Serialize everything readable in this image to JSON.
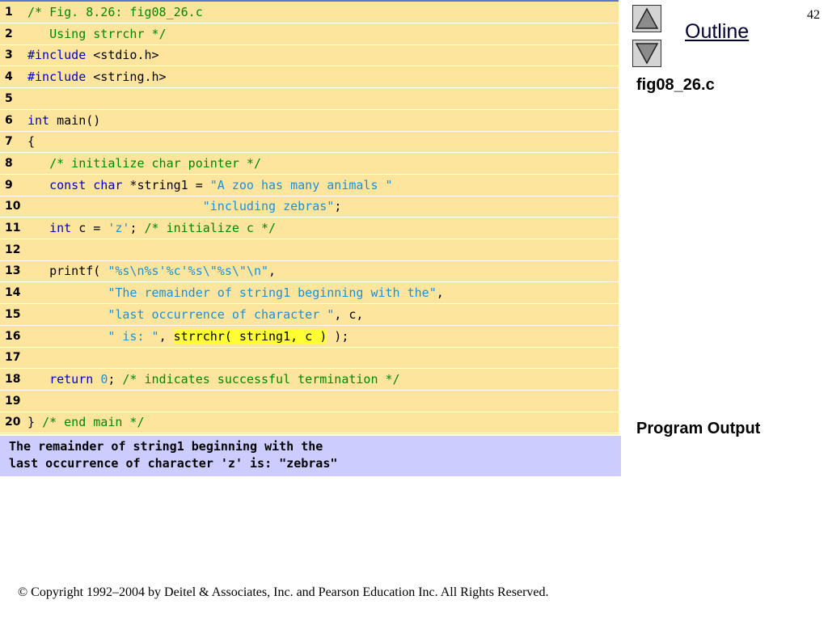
{
  "slide_number": "42",
  "nav": {
    "outline_label": "Outline",
    "up_icon": "triangle-up-icon",
    "down_icon": "triangle-down-icon"
  },
  "file_label": "fig08_26.c",
  "program_output_label": "Program Output",
  "code": [
    {
      "n": "1",
      "parts": [
        [
          "cm",
          "/* Fig. 8.26: fig08_26.c"
        ]
      ]
    },
    {
      "n": "2",
      "parts": [
        [
          "cm",
          "   Using strrchr */"
        ]
      ]
    },
    {
      "n": "3",
      "parts": [
        [
          "kw",
          "#include"
        ],
        [
          "",
          " <stdio.h>"
        ]
      ]
    },
    {
      "n": "4",
      "parts": [
        [
          "kw",
          "#include"
        ],
        [
          "",
          " <string.h>"
        ]
      ]
    },
    {
      "n": "5",
      "parts": []
    },
    {
      "n": "6",
      "parts": [
        [
          "kw",
          "int"
        ],
        [
          "",
          " main()"
        ]
      ]
    },
    {
      "n": "7",
      "parts": [
        [
          "",
          "{"
        ]
      ]
    },
    {
      "n": "8",
      "parts": [
        [
          "",
          "   "
        ],
        [
          "cm",
          "/* initialize char pointer */"
        ]
      ]
    },
    {
      "n": "9",
      "parts": [
        [
          "",
          "   "
        ],
        [
          "kw",
          "const"
        ],
        [
          "",
          " "
        ],
        [
          "kw",
          "char"
        ],
        [
          "",
          " *string1 = "
        ],
        [
          "st",
          "\"A zoo has many animals \""
        ]
      ]
    },
    {
      "n": "10",
      "parts": [
        [
          "",
          "                        "
        ],
        [
          "st",
          "\"including zebras\""
        ],
        [
          "",
          ";"
        ]
      ]
    },
    {
      "n": "11",
      "parts": [
        [
          "",
          "   "
        ],
        [
          "kw",
          "int"
        ],
        [
          "",
          " c = "
        ],
        [
          "st",
          "'z'"
        ],
        [
          "",
          "; "
        ],
        [
          "cm",
          "/* initialize c */"
        ]
      ]
    },
    {
      "n": "12",
      "parts": []
    },
    {
      "n": "13",
      "parts": [
        [
          "",
          "   printf( "
        ],
        [
          "st",
          "\"%s\\n%s'%c'%s\\\"%s\\\"\\n\""
        ],
        [
          "",
          ","
        ]
      ]
    },
    {
      "n": "14",
      "parts": [
        [
          "",
          "           "
        ],
        [
          "st",
          "\"The remainder of string1 beginning with the\""
        ],
        [
          "",
          ","
        ]
      ]
    },
    {
      "n": "15",
      "parts": [
        [
          "",
          "           "
        ],
        [
          "st",
          "\"last occurrence of character \""
        ],
        [
          "",
          ", c,"
        ]
      ]
    },
    {
      "n": "16",
      "parts": [
        [
          "",
          "           "
        ],
        [
          "st",
          "\" is: \""
        ],
        [
          "",
          ", "
        ],
        [
          "hl",
          "strrchr( string1, c )"
        ],
        [
          "",
          " );"
        ]
      ]
    },
    {
      "n": "17",
      "parts": []
    },
    {
      "n": "18",
      "parts": [
        [
          "",
          "   "
        ],
        [
          "kw",
          "return"
        ],
        [
          "",
          " "
        ],
        [
          "st",
          "0"
        ],
        [
          "",
          "; "
        ],
        [
          "cm",
          "/* indicates successful termination */"
        ]
      ]
    },
    {
      "n": "19",
      "parts": []
    },
    {
      "n": "20",
      "parts": [
        [
          "",
          "} "
        ],
        [
          "cm",
          "/* end main */"
        ]
      ]
    }
  ],
  "output": [
    "The remainder of string1 beginning with the",
    "last occurrence of character 'z' is: \"zebras\""
  ],
  "copyright": "© Copyright 1992–2004 by Deitel & Associates, Inc. and Pearson Education Inc. All Rights Reserved.",
  "colors": {
    "code_background": "#fde59e",
    "output_background": "#ccccff",
    "comment": "#008800",
    "keyword": "#0000cc",
    "string_literal": "#1a90d8",
    "highlight": "#ffff33"
  }
}
